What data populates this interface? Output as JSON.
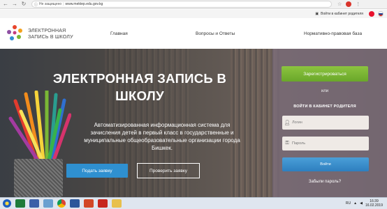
{
  "browser": {
    "security_label": "Не защищено",
    "url": "www.mektep.edu.gov.kg"
  },
  "topbar": {
    "login_label": "Войти в кабинет родителя"
  },
  "header": {
    "logo_line1": "ЭЛЕКТРОННАЯ",
    "logo_line2": "ЗАПИСЬ В ШКОЛУ",
    "nav": [
      {
        "label": "Главная"
      },
      {
        "label": "Вопросы и Ответы"
      },
      {
        "label": "Нормативно-правовая база"
      }
    ]
  },
  "hero": {
    "title": "ЭЛЕКТРОННАЯ ЗАПИСЬ В ШКОЛУ",
    "subtitle": "Автоматизированная информационная система для зачисления детей в первый класс в государственные и муниципальные общеобразовательные организации города Бишкек.",
    "submit_label": "Подать заявку",
    "check_label": "Проверить заявку"
  },
  "panel": {
    "register_label": "Зарегистрироваться",
    "or_label": "или",
    "title": "ВОЙТИ В КАБИНЕТ РОДИТЕЛЯ",
    "login_placeholder": "Логин",
    "password_placeholder": "Пароль",
    "enter_label": "Войти",
    "forgot_label": "Забыли пароль?"
  },
  "taskbar": {
    "lang": "RU",
    "time": "16:39",
    "date": "16.02.2019"
  },
  "colors": {
    "register_green": "#7ab735",
    "primary_blue": "#2f90d0"
  }
}
